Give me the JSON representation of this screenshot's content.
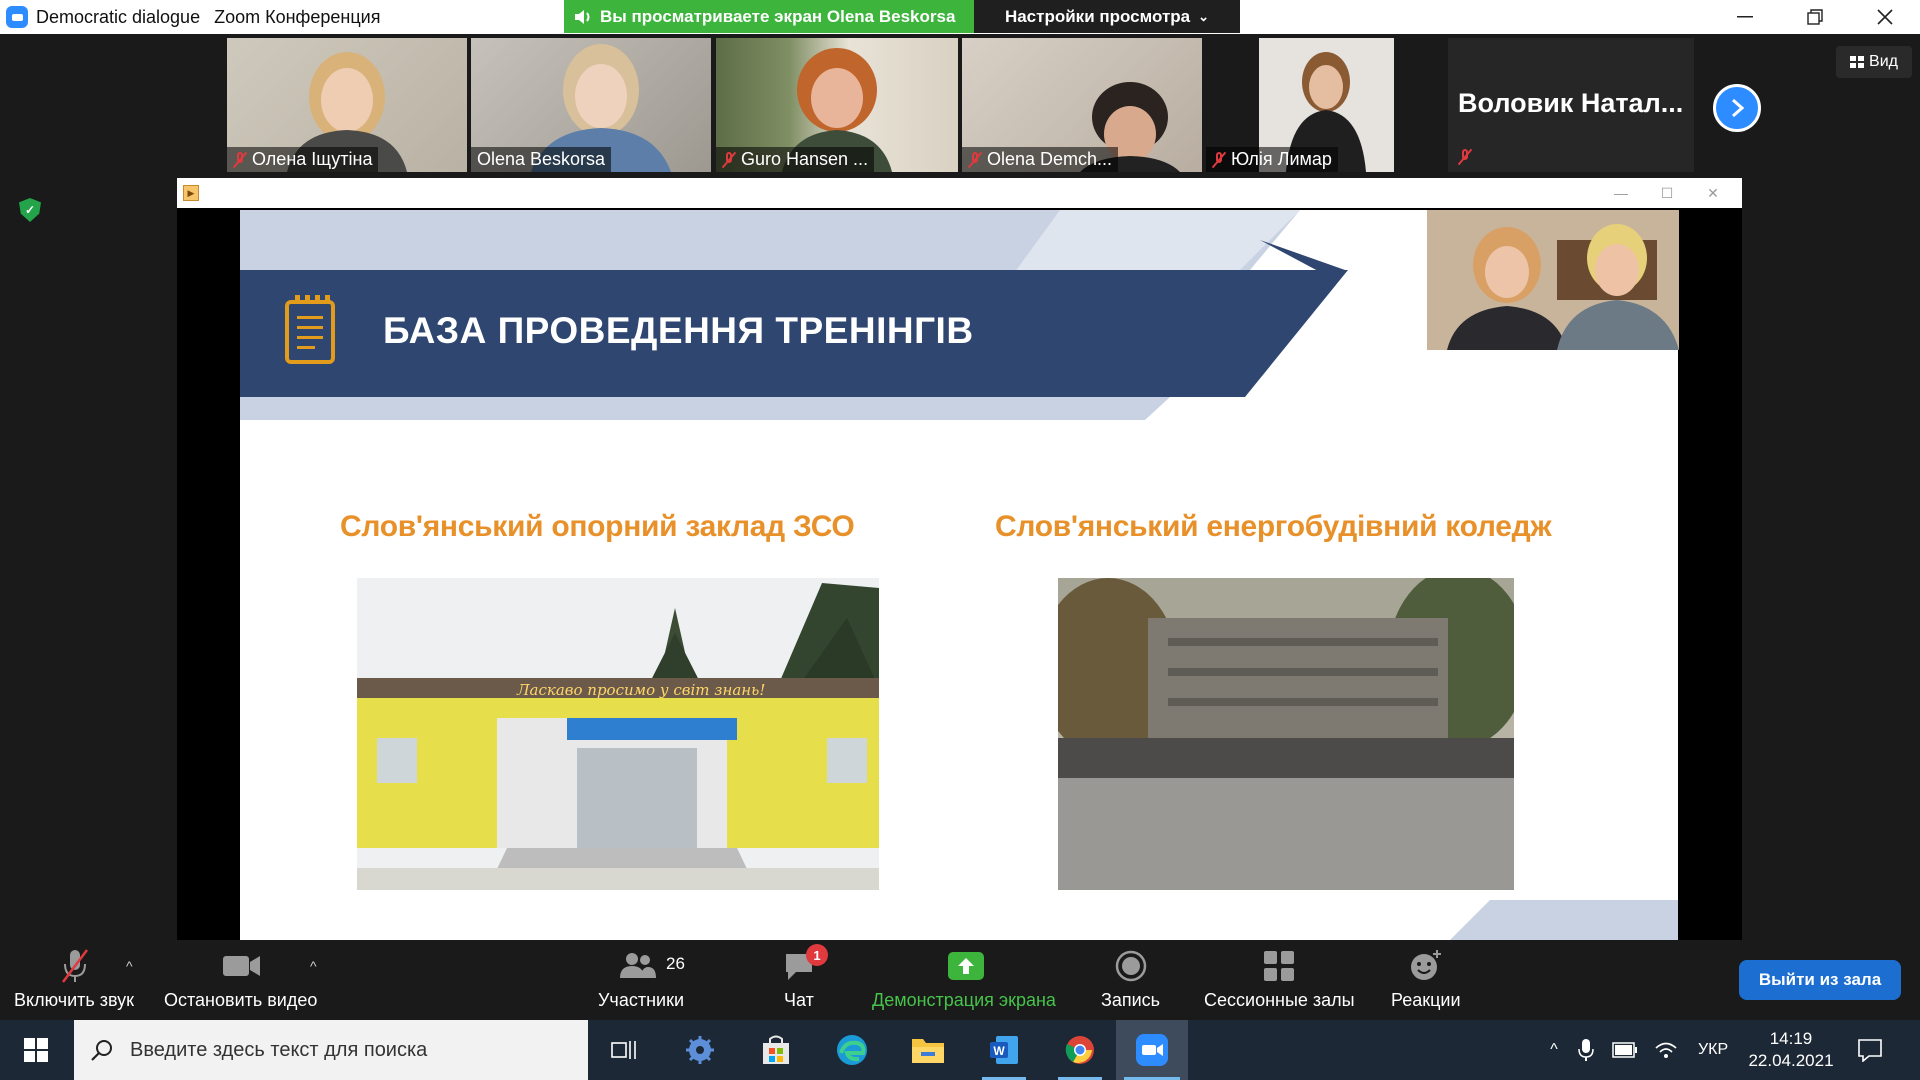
{
  "window": {
    "app_name": "Democratic dialogue",
    "title": "Zoom Конференция",
    "share_banner": "Вы просматриваете экран Olena Beskorsa",
    "view_settings": "Настройки просмотра"
  },
  "gallery": {
    "participants": [
      {
        "name": "Олена Іщутіна",
        "muted": true
      },
      {
        "name": "Olena Beskorsa",
        "muted": false
      },
      {
        "name": "Guro Hansen ...",
        "muted": true,
        "active": true
      },
      {
        "name": "Olena Demch...",
        "muted": true
      },
      {
        "name": "Юлія Лимар",
        "muted": true
      }
    ],
    "name_only_tile": "Воловик  Натал...",
    "view_label": "Вид"
  },
  "slide": {
    "title": "БАЗА ПРОВЕДЕННЯ ТРЕНІНГІВ",
    "left_label": "Слов'янський опорний заклад ЗСО",
    "right_label": "Слов'янський енергобудівний коледж",
    "sign_text": "Ласкаво просимо у світ знань!"
  },
  "toolbar": {
    "unmute": "Включить звук",
    "stop_video": "Остановить видео",
    "participants": "Участники",
    "participants_count": "26",
    "chat": "Чат",
    "chat_badge": "1",
    "share_screen": "Демонстрация экрана",
    "record": "Запись",
    "breakout": "Сессионные залы",
    "reactions": "Реакции",
    "leave": "Выйти из зала"
  },
  "taskbar": {
    "search_placeholder": "Введите здесь текст для поиска",
    "language": "УКР",
    "time": "14:19",
    "date": "22.04.2021"
  },
  "colors": {
    "slide_navy": "#2f4670",
    "slide_orange": "#e8912a",
    "zoom_blue": "#2d8cff",
    "share_green": "#3db53d"
  }
}
